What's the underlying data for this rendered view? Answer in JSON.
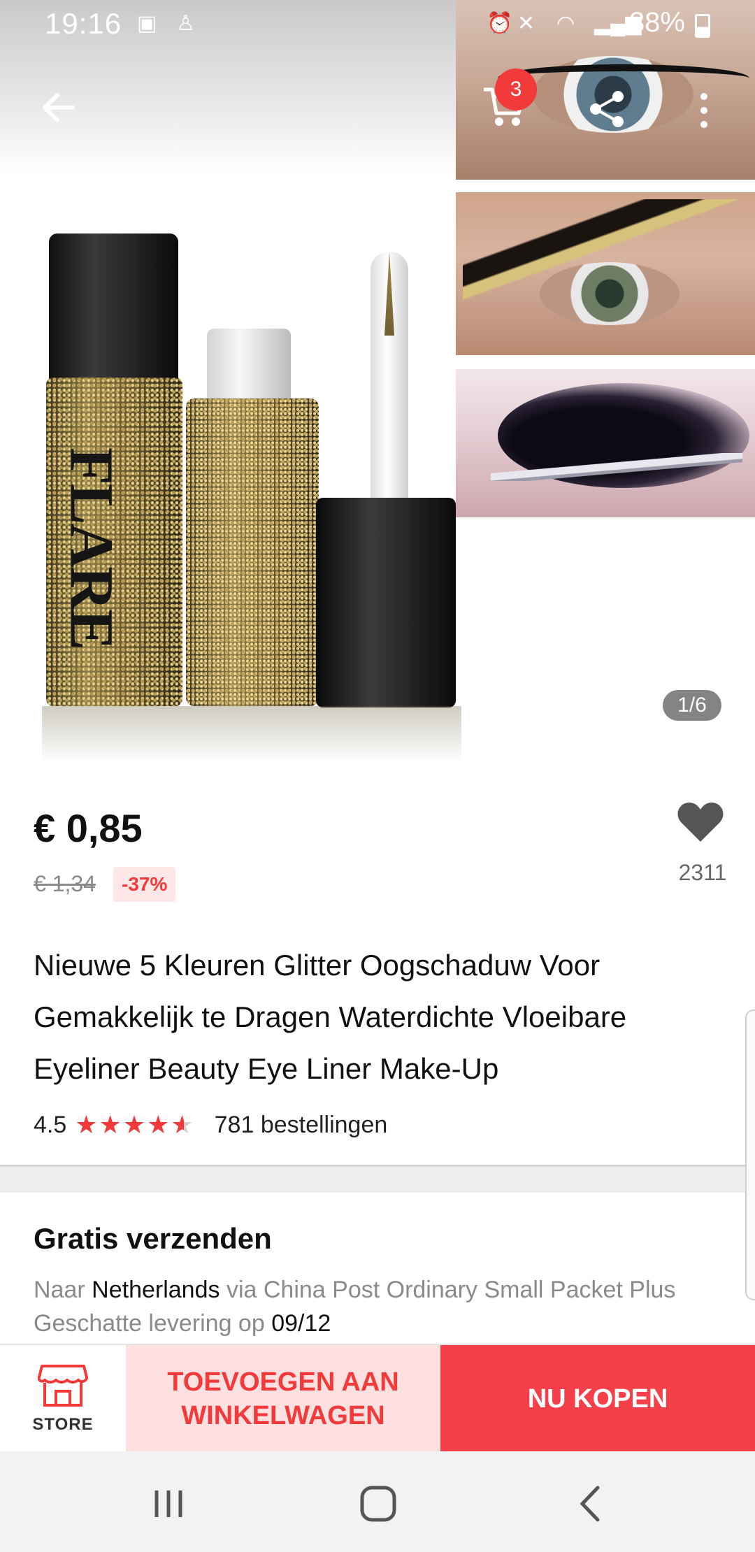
{
  "status_bar": {
    "time": "19:16",
    "battery": "38%"
  },
  "top_bar": {
    "cart_count": "3"
  },
  "gallery": {
    "counter": "1/6",
    "product_label": "FLARE"
  },
  "product": {
    "price": "€ 0,85",
    "original_price": "€ 1,34",
    "discount": "-37%",
    "wishlist_count": "2311",
    "title": "Nieuwe 5 Kleuren Glitter Oogschaduw Voor Gemakkelijk te Dragen Waterdichte Vloeibare Eyeliner Beauty Eye Liner Make-Up",
    "rating": "4.5",
    "rating_value": 4.5,
    "orders": "781 bestellingen"
  },
  "shipping": {
    "title": "Gratis verzenden",
    "to_prefix": "Naar",
    "country": "Netherlands",
    "via": "via China Post Ordinary Small Packet Plus",
    "delivery_prefix": "Geschatte levering op",
    "delivery_date": "09/12"
  },
  "actions": {
    "store_label": "STORE",
    "add_to_cart": "TOEVOEGEN AAN WINKELWAGEN",
    "buy_now": "NU KOPEN"
  },
  "colors": {
    "accent": "#f23a3a",
    "accent_light": "#ffe0e0"
  }
}
